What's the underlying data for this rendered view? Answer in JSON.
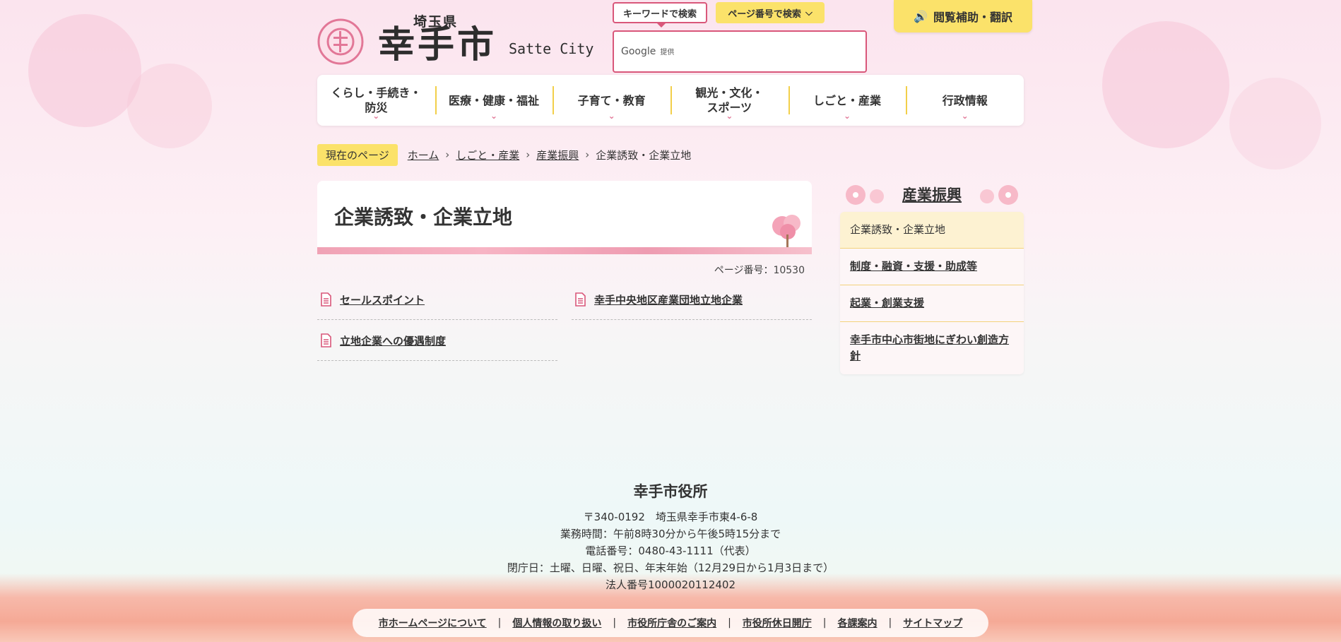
{
  "header": {
    "pref": "埼玉県",
    "city": "幸手市",
    "city_en": "Satte City",
    "search_keyword_tab": "キーワードで検索",
    "search_page_tab": "ページ番号で検索",
    "search_provider": "Google",
    "search_provider_note": "提供",
    "assist_label": "閲覧補助・翻訳"
  },
  "nav": [
    {
      "label": "くらし・手続き・防災"
    },
    {
      "label": "医療・健康・福祉"
    },
    {
      "label": "子育て・教育"
    },
    {
      "label": "観光・文化・スポーツ"
    },
    {
      "label": "しごと・産業"
    },
    {
      "label": "行政情報"
    }
  ],
  "breadcrumb": {
    "label": "現在のページ",
    "items": [
      "ホーム",
      "しごと・産業",
      "産業振興",
      "企業誘致・企業立地"
    ]
  },
  "main": {
    "title": "企業誘致・企業立地",
    "page_number": "ページ番号：10530",
    "links": [
      "セールスポイント",
      "幸手中央地区産業団地立地企業",
      "立地企業への優遇制度"
    ]
  },
  "side": {
    "title": "産業振興",
    "items": [
      "企業誘致・企業立地",
      "制度・融資・支援・助成等",
      "起業・創業支援",
      "幸手市中心市街地にぎわい創造方針"
    ]
  },
  "footer": {
    "name": "幸手市役所",
    "address": "〒340-0192　埼玉県幸手市東4-6-8",
    "hours": "業務時間：午前8時30分から午後5時15分まで",
    "phone": "電話番号：0480-43-1111（代表）",
    "closed": "閉庁日：土曜、日曜、祝日、年末年始（12月29日から1月3日まで）",
    "corp": "法人番号1000020112402",
    "links": [
      "市ホームページについて",
      "個人情報の取り扱い",
      "市役所庁舎のご案内",
      "市役所休日開庁",
      "各課案内",
      "サイトマップ"
    ]
  },
  "colors": {
    "accent": "#d9577a",
    "yellow": "#fbe26a"
  }
}
